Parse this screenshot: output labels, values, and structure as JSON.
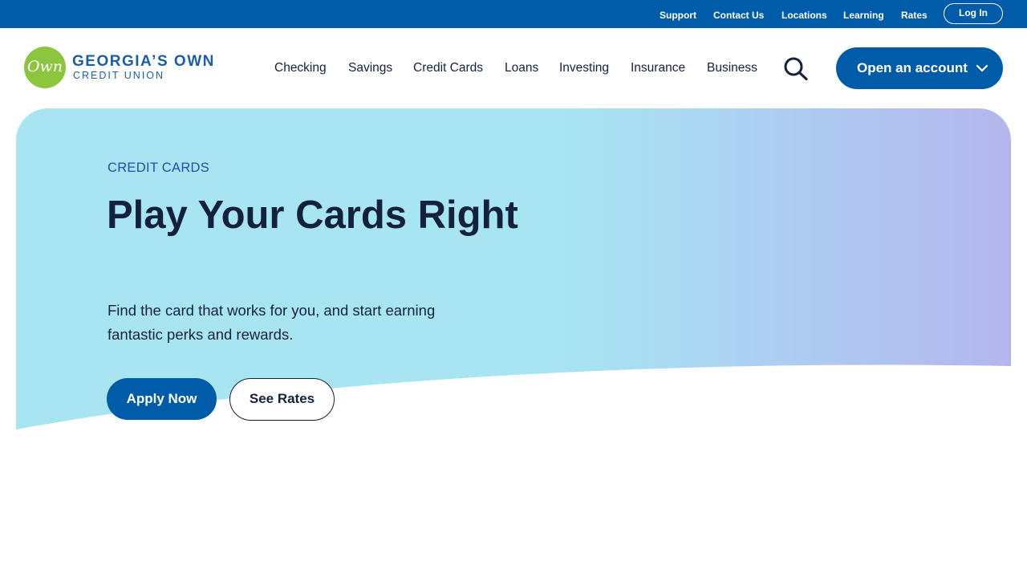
{
  "utility_nav": {
    "items": [
      {
        "label": "Support"
      },
      {
        "label": "Contact Us"
      },
      {
        "label": "Locations"
      },
      {
        "label": "Learning"
      },
      {
        "label": "Rates"
      }
    ],
    "login_label": "Log In"
  },
  "logo": {
    "mark": "Own",
    "name": "GEORGIA’S OWN",
    "subtitle": "CREDIT UNION"
  },
  "main_nav": {
    "items": [
      {
        "label": "Checking"
      },
      {
        "label": "Savings"
      },
      {
        "label": "Credit Cards"
      },
      {
        "label": "Loans"
      },
      {
        "label": "Investing"
      },
      {
        "label": "Insurance"
      },
      {
        "label": "Business"
      }
    ],
    "search_icon": "search-icon",
    "open_account_label": "Open an account",
    "open_account_icon": "chevron-down-icon"
  },
  "hero": {
    "eyebrow": "CREDIT CARDS",
    "headline": "Play Your Cards Right",
    "subcopy": "Find the card that works for you, and start earning fantastic perks and rewards.",
    "primary_button": "Apply Now",
    "secondary_button": "See Rates"
  },
  "colors": {
    "brand_blue": "#005ca8",
    "brand_green": "#8cc63f",
    "navy_text": "#14213d",
    "eyebrow_blue": "#1f4fb2",
    "hero_cyan": "#a7e5f3",
    "hero_lavender": "#b4b5ec"
  }
}
